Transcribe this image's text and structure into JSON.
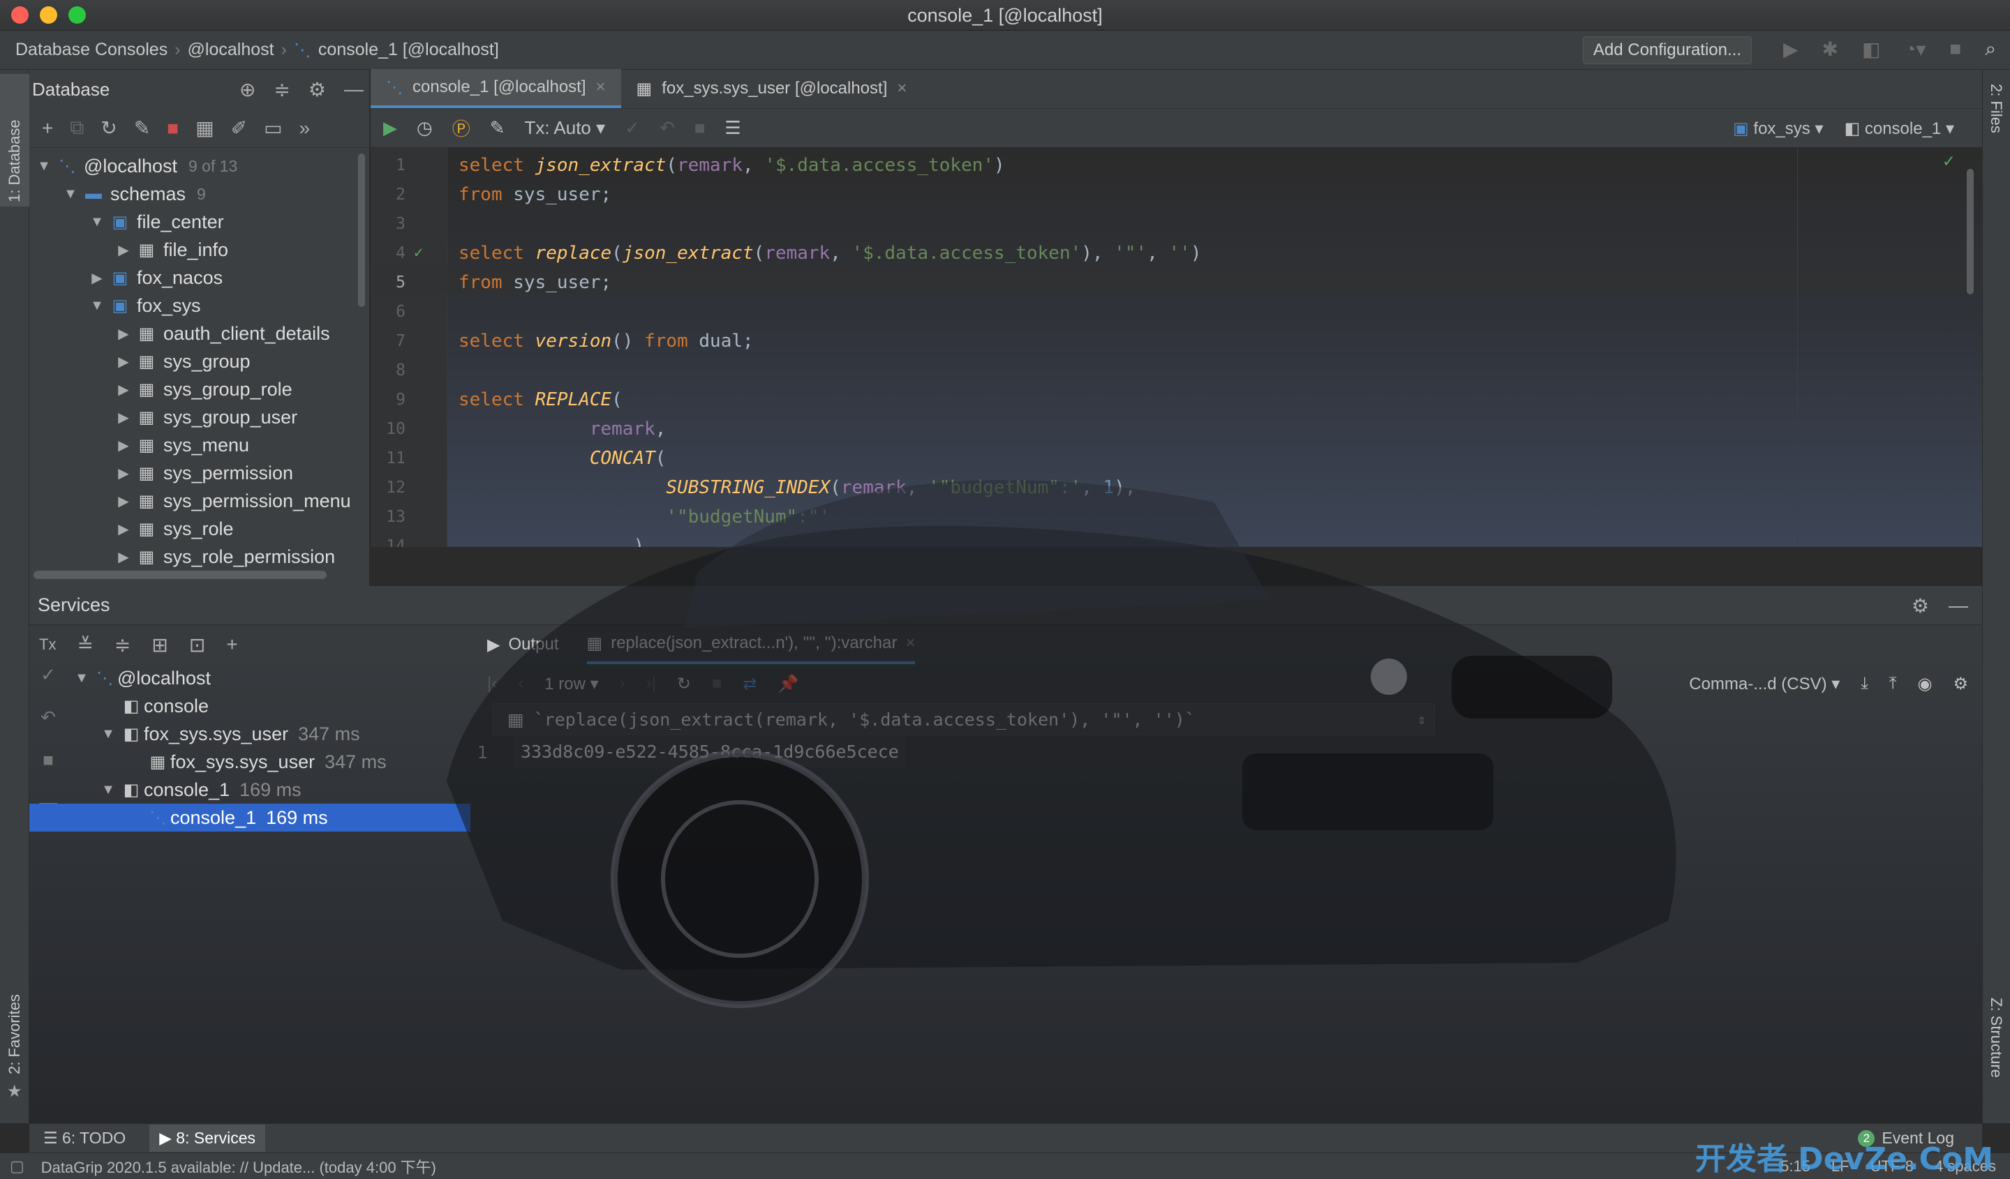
{
  "window": {
    "title": "console_1 [@localhost]"
  },
  "navbar": {
    "crumbs": [
      "Database Consoles",
      "@localhost",
      "console_1 [@localhost]"
    ],
    "add_configuration": "Add Configuration..."
  },
  "side_tabs": {
    "database": "1: Database",
    "favorites": "2: Favorites",
    "files": "2: Files",
    "structure": "Z: Structure"
  },
  "db_panel": {
    "title": "Database",
    "tree": [
      {
        "label": "@localhost",
        "count": "9 of 13",
        "level": 0,
        "icon": "datasource-icon",
        "expanded": true
      },
      {
        "label": "schemas",
        "count": "9",
        "level": 1,
        "icon": "folder-icon",
        "expanded": true
      },
      {
        "label": "file_center",
        "count": "",
        "level": 2,
        "icon": "schema-icon",
        "expanded": true
      },
      {
        "label": "file_info",
        "count": "",
        "level": 3,
        "icon": "table-icon",
        "expanded": false
      },
      {
        "label": "fox_nacos",
        "count": "",
        "level": 2,
        "icon": "schema-icon",
        "expanded": false
      },
      {
        "label": "fox_sys",
        "count": "",
        "level": 2,
        "icon": "schema-icon",
        "expanded": true
      },
      {
        "label": "oauth_client_details",
        "count": "",
        "level": 3,
        "icon": "table-icon",
        "expanded": false
      },
      {
        "label": "sys_group",
        "count": "",
        "level": 3,
        "icon": "table-icon",
        "expanded": false
      },
      {
        "label": "sys_group_role",
        "count": "",
        "level": 3,
        "icon": "table-icon",
        "expanded": false
      },
      {
        "label": "sys_group_user",
        "count": "",
        "level": 3,
        "icon": "table-icon",
        "expanded": false
      },
      {
        "label": "sys_menu",
        "count": "",
        "level": 3,
        "icon": "table-icon",
        "expanded": false
      },
      {
        "label": "sys_permission",
        "count": "",
        "level": 3,
        "icon": "table-icon",
        "expanded": false
      },
      {
        "label": "sys_permission_menu",
        "count": "",
        "level": 3,
        "icon": "table-icon",
        "expanded": false
      },
      {
        "label": "sys_role",
        "count": "",
        "level": 3,
        "icon": "table-icon",
        "expanded": false
      },
      {
        "label": "sys_role_permission",
        "count": "",
        "level": 3,
        "icon": "table-icon",
        "expanded": false
      }
    ]
  },
  "editor": {
    "tabs": [
      {
        "label": "console_1 [@localhost]",
        "active": true,
        "icon": "console-icon"
      },
      {
        "label": "fox_sys.sys_user [@localhost]",
        "active": false,
        "icon": "table-icon"
      }
    ],
    "tx_mode": "Tx: Auto",
    "schema": "fox_sys",
    "console": "console_1",
    "lines": [
      {
        "n": "1",
        "tokens": [
          [
            "kw",
            "select "
          ],
          [
            "fn",
            "json_extract"
          ],
          [
            "pl",
            "("
          ],
          [
            "id",
            "remark"
          ],
          [
            "pl",
            ", "
          ],
          [
            "str",
            "'$.data.access_token'"
          ],
          [
            "pl",
            ")"
          ]
        ]
      },
      {
        "n": "2",
        "tokens": [
          [
            "kw",
            "from "
          ],
          [
            "pl",
            "sys_user;"
          ]
        ]
      },
      {
        "n": "3",
        "tokens": []
      },
      {
        "n": "4",
        "tokens": [
          [
            "kw",
            "select "
          ],
          [
            "fn",
            "replace"
          ],
          [
            "pl",
            "("
          ],
          [
            "fn",
            "json_extract"
          ],
          [
            "pl",
            "("
          ],
          [
            "id",
            "remark"
          ],
          [
            "pl",
            ", "
          ],
          [
            "str",
            "'$.data.access_token'"
          ],
          [
            "pl",
            "), "
          ],
          [
            "str",
            "'\"'"
          ],
          [
            "pl",
            ", "
          ],
          [
            "str",
            "''"
          ],
          [
            "pl",
            ")"
          ]
        ]
      },
      {
        "n": "5",
        "tokens": [
          [
            "kw",
            "from "
          ],
          [
            "pl",
            "sys_user;"
          ]
        ]
      },
      {
        "n": "6",
        "tokens": []
      },
      {
        "n": "7",
        "tokens": [
          [
            "kw",
            "select "
          ],
          [
            "fn",
            "version"
          ],
          [
            "pl",
            "() "
          ],
          [
            "kw",
            "from "
          ],
          [
            "pl",
            "dual;"
          ]
        ]
      },
      {
        "n": "8",
        "tokens": []
      },
      {
        "n": "9",
        "tokens": [
          [
            "kw",
            "select "
          ],
          [
            "fn",
            "REPLACE"
          ],
          [
            "pl",
            "("
          ]
        ]
      },
      {
        "n": "10",
        "tokens": [
          [
            "pl",
            "            "
          ],
          [
            "id",
            "remark"
          ],
          [
            "pl",
            ","
          ]
        ]
      },
      {
        "n": "11",
        "tokens": [
          [
            "pl",
            "            "
          ],
          [
            "fn",
            "CONCAT"
          ],
          [
            "pl",
            "("
          ]
        ]
      },
      {
        "n": "12",
        "tokens": [
          [
            "pl",
            "                   "
          ],
          [
            "fn",
            "SUBSTRING_INDEX"
          ],
          [
            "pl",
            "("
          ],
          [
            "id",
            "remark"
          ],
          [
            "pl",
            ", "
          ],
          [
            "str",
            "'\"budgetNum\":'"
          ],
          [
            "pl",
            ", "
          ],
          [
            "num",
            "1"
          ],
          [
            "pl",
            "),"
          ]
        ]
      },
      {
        "n": "13",
        "tokens": [
          [
            "pl",
            "                   "
          ],
          [
            "str",
            "'\"budgetNum\":\"'"
          ]
        ]
      },
      {
        "n": "14",
        "tokens": [
          [
            "pl",
            "                ),"
          ]
        ]
      }
    ]
  },
  "services": {
    "title": "Services",
    "tree": [
      {
        "label": "@localhost",
        "time": "",
        "level": 0,
        "selected": false
      },
      {
        "label": "console",
        "time": "",
        "level": 1,
        "selected": false
      },
      {
        "label": "fox_sys.sys_user",
        "time": "347 ms",
        "level": 1,
        "selected": false
      },
      {
        "label": "fox_sys.sys_user",
        "time": "347 ms",
        "level": 2,
        "selected": false
      },
      {
        "label": "console_1",
        "time": "169 ms",
        "level": 1,
        "selected": false
      },
      {
        "label": "console_1",
        "time": "169 ms",
        "level": 2,
        "selected": true
      }
    ],
    "output_tab": "Output",
    "result_tab": "replace(json_extract...n'), '\"', ''):varchar",
    "rows_label": "1 row",
    "export_format": "Comma-...d (CSV)",
    "column_header": "`replace(json_extract(remark, '$.data.access_token'), '\"', '')`",
    "rows": [
      {
        "n": "1",
        "value": "333d8c09-e522-4585-8cca-1d9c66e5cece"
      }
    ]
  },
  "bottom_tabs": [
    {
      "label": "6: TODO"
    },
    {
      "label": "8: Services"
    }
  ],
  "event_log": {
    "count": "2",
    "label": "Event Log"
  },
  "status": {
    "message": "DataGrip 2020.1.5 available: // Update... (today 4:00 下午)",
    "position": "5:15",
    "line_sep": "LF",
    "encoding": "UTF-8",
    "indent": "4 spaces"
  },
  "watermark": "开发者 DevZe.CoM",
  "colors": {
    "accent": "#4a88c7",
    "selection": "#2f65ca",
    "keyword": "#cc7832",
    "function": "#ffc66d",
    "string": "#6a8759",
    "number": "#6897bb",
    "identifier": "#9876aa"
  }
}
